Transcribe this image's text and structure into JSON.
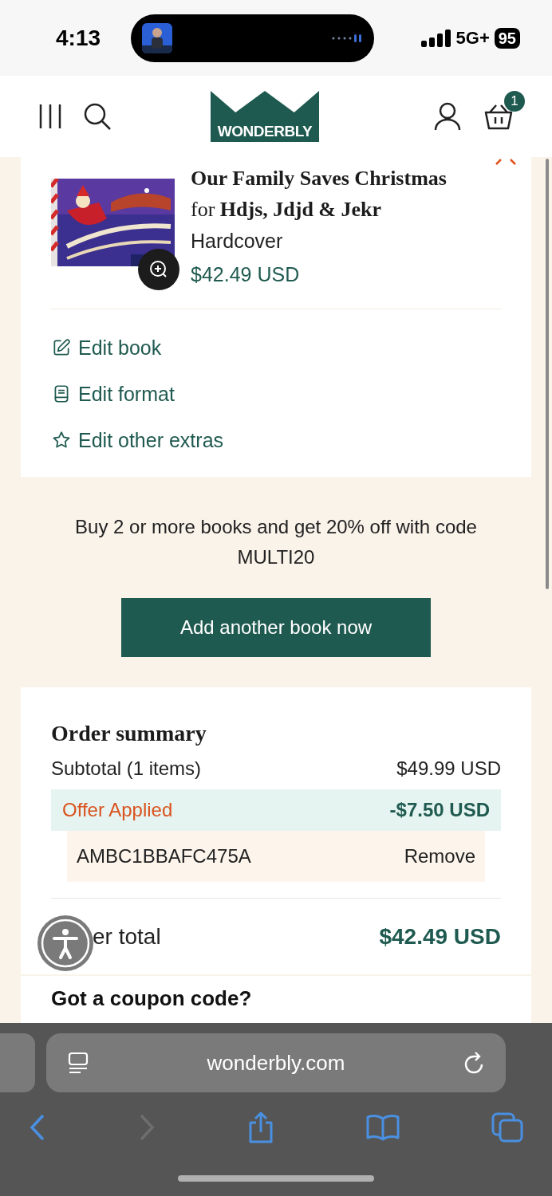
{
  "status_bar": {
    "time": "4:13",
    "network": "5G+",
    "battery": "95"
  },
  "header": {
    "logo": "WONDERBLY",
    "cart_count": "1"
  },
  "cart_item": {
    "title": "Our Family Saves Christmas",
    "subtitle": "for **Hdjs, Jdjd & Jekr**",
    "format": "Hardcover",
    "price": "$42.49 USD",
    "actions": [
      {
        "kind": "edit",
        "label": "Edit book"
      },
      {
        "kind": "format",
        "label": "Edit format"
      },
      {
        "kind": "extras",
        "label": "Edit other extras"
      }
    ]
  },
  "promo": {
    "text": "Buy 2 or more books and get 20% off with code MULTI20",
    "button": "Add another book now"
  },
  "summary": {
    "title": "Order summary",
    "subtotal_label": "Subtotal (1 items)",
    "subtotal": "$49.99 USD",
    "offer_label": "Offer Applied",
    "offer_amount": "-$7.50 USD",
    "code": "AMBC1BBAFC475A",
    "remove": "Remove",
    "total_label": "er total",
    "total": "$42.49 USD"
  },
  "coupon": {
    "title": "Got a coupon code?"
  },
  "browser": {
    "url": "wonderbly.com"
  }
}
